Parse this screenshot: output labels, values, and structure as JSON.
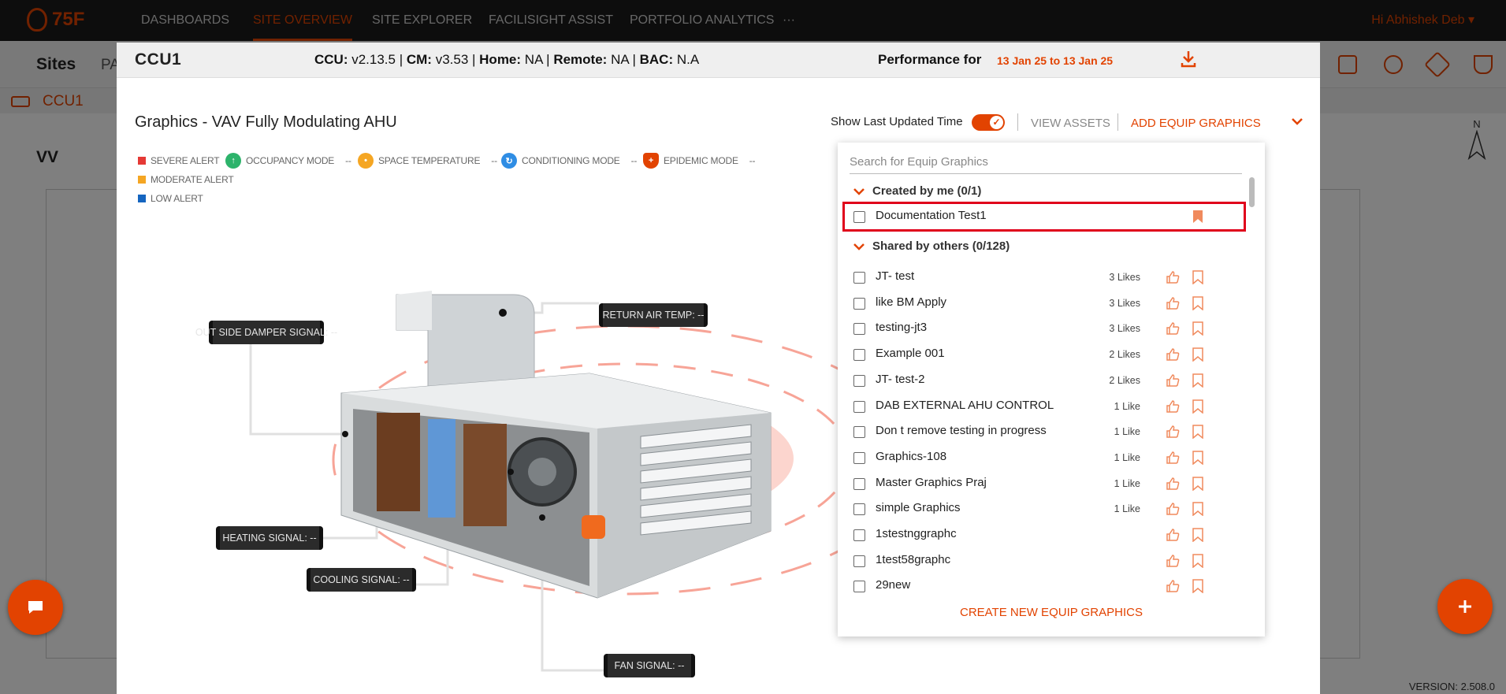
{
  "app": {
    "brand": "75F",
    "nav": [
      "DASHBOARDS",
      "SITE OVERVIEW",
      "SITE EXPLORER",
      "FACILISIGHT ASSIST",
      "PORTFOLIO ANALYTICS",
      "···"
    ],
    "active_nav": "SITE OVERVIEW",
    "greeting": "Hi",
    "user_name": "Abhishek Deb"
  },
  "background": {
    "sites_title": "Sites",
    "sites_tab": "PA",
    "breadcrumb": "CCU1",
    "zone_title": "VV",
    "dashes": [
      "--",
      "--",
      "--",
      "--",
      "--",
      "--"
    ],
    "version": "VERSION: 2.508.0",
    "north": "N"
  },
  "modal": {
    "title": "CCU1",
    "ccu_label": "CCU:",
    "ccu_value": " v2.13.5 | ",
    "cm_label": "CM:",
    "cm_value": " v3.53 | ",
    "home_label": "Home:",
    "home_value": " NA | ",
    "remote_label": "Remote:",
    "remote_value": " NA | ",
    "bac_label": "BAC:",
    "bac_value": " N.A",
    "performance_label": "Performance for",
    "performance_range": "13 Jan 25 to 13 Jan 25",
    "graphics_title": "Graphics - VAV Fully Modulating AHU",
    "legend": {
      "severe": "SEVERE ALERT",
      "moderate": "MODERATE ALERT",
      "low": "LOW ALERT",
      "occupancy": "OCCUPANCY MODE",
      "space_temp": "SPACE TEMPERATURE",
      "conditioning": "CONDITIONING MODE",
      "epidemic": "EPIDEMIC MODE",
      "dash": "--"
    },
    "colors": {
      "accent": "#e24301",
      "severe": "#e53935",
      "moderate": "#f5a623",
      "low": "#1565c0",
      "occupancy": "#2db36b",
      "space_temp": "#f5a623",
      "conditioning": "#2f8de4",
      "epidemic": "#e24301"
    },
    "callouts": {
      "outside_damper": "OUT SIDE DAMPER SIGNAL: --",
      "return_air": "RETURN AIR TEMP: --",
      "heating": "HEATING SIGNAL: --",
      "cooling": "COOLING SIGNAL: --",
      "fan": "FAN SIGNAL: --"
    },
    "show_last_updated": "Show Last Updated Time",
    "view_assets": "VIEW ASSETS",
    "add_equip_graphics": "ADD EQUIP GRAPHICS"
  },
  "dropdown": {
    "search_placeholder": "Search for Equip Graphics",
    "created_header": "Created by me (0/1)",
    "created_items": [
      {
        "label": "Documentation Test1"
      }
    ],
    "shared_header": "Shared by others (0/128)",
    "shared_items": [
      {
        "label": "JT- test",
        "likes": "3 Likes"
      },
      {
        "label": "like BM Apply",
        "likes": "3 Likes"
      },
      {
        "label": "testing-jt3",
        "likes": "3 Likes"
      },
      {
        "label": "Example 001",
        "likes": "2 Likes"
      },
      {
        "label": "JT- test-2",
        "likes": "2 Likes"
      },
      {
        "label": "DAB EXTERNAL AHU CONTROL",
        "likes": "1 Like"
      },
      {
        "label": "Don t remove testing in progress",
        "likes": "1 Like"
      },
      {
        "label": "Graphics-108",
        "likes": "1 Like"
      },
      {
        "label": "Master Graphics Praj",
        "likes": "1 Like"
      },
      {
        "label": "simple Graphics",
        "likes": "1 Like"
      },
      {
        "label": "1stestnggraphc",
        "likes": ""
      },
      {
        "label": "1test58graphc",
        "likes": ""
      },
      {
        "label": "29new",
        "likes": ""
      }
    ],
    "create_new": "CREATE NEW EQUIP GRAPHICS"
  }
}
